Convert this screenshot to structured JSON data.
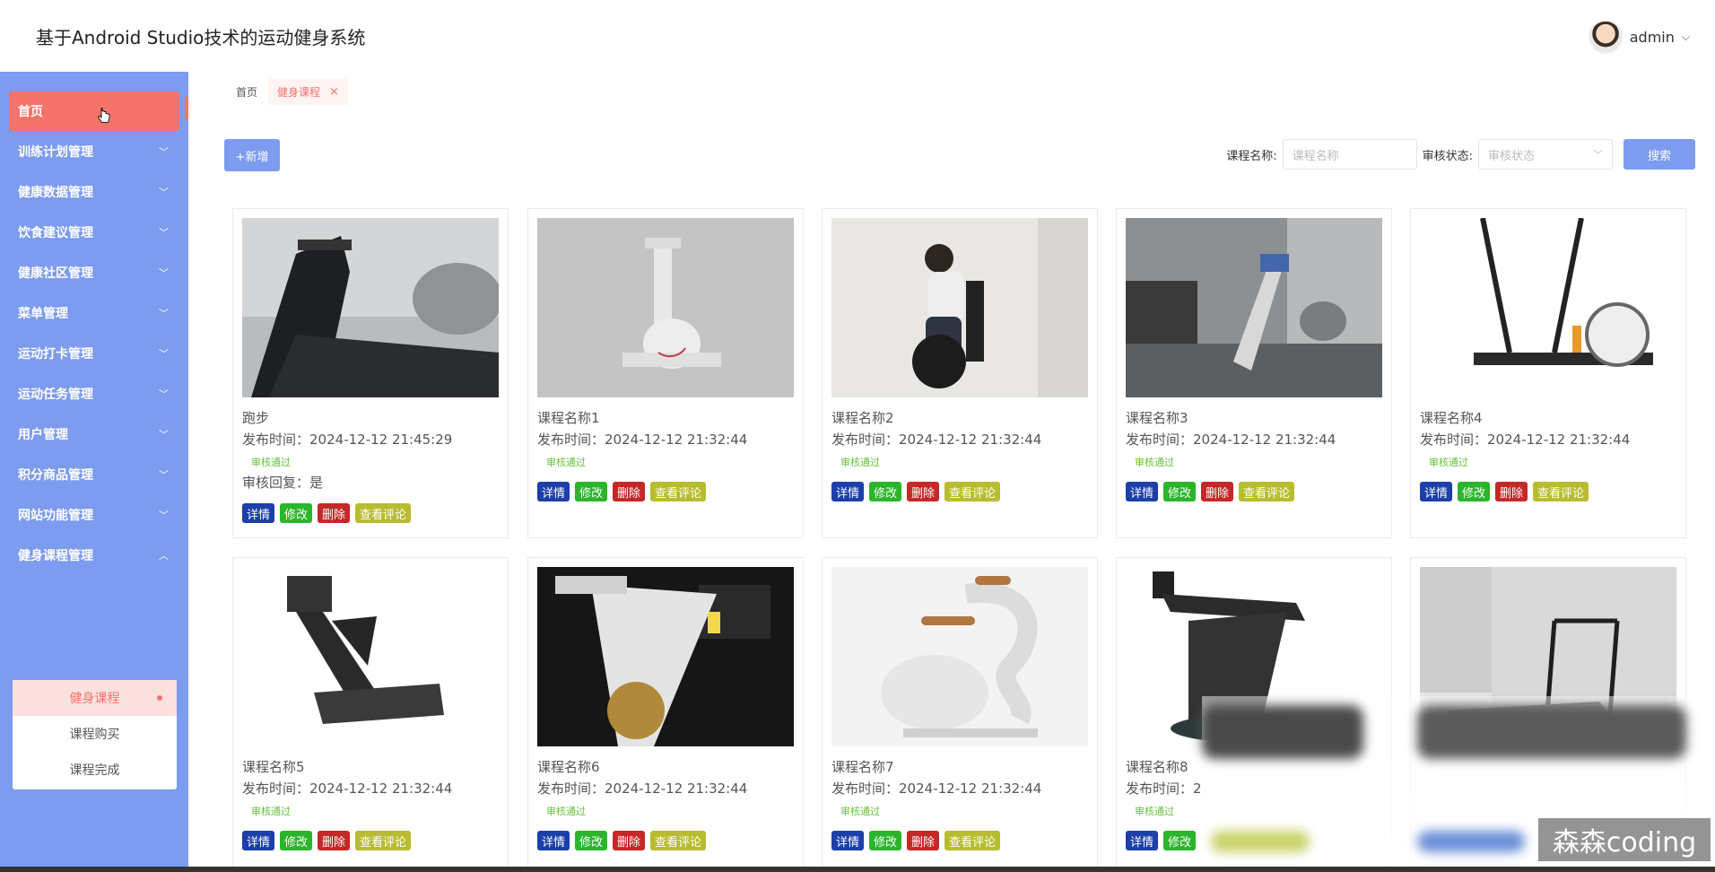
{
  "header": {
    "title": "基于Android Studio技术的运动健身系统",
    "user": "admin",
    "user_chevron": "⌵"
  },
  "sidebar": {
    "items": [
      {
        "label": "首页",
        "icon": "pointer-hand-icon"
      },
      {
        "label": "训练计划管理"
      },
      {
        "label": "健康数据管理"
      },
      {
        "label": "饮食建议管理"
      },
      {
        "label": "健康社区管理"
      },
      {
        "label": "菜单管理"
      },
      {
        "label": "运动打卡管理"
      },
      {
        "label": "运动任务管理"
      },
      {
        "label": "用户管理"
      },
      {
        "label": "积分商品管理"
      },
      {
        "label": "网站功能管理"
      },
      {
        "label": "健身课程管理"
      }
    ],
    "submenu": [
      {
        "label": "健身课程"
      },
      {
        "label": "课程购买"
      },
      {
        "label": "课程完成"
      }
    ],
    "colors": {
      "bg": "#7d9bef",
      "active": "#f5736a"
    }
  },
  "breadcrumb": {
    "home": "首页",
    "current": "健身课程",
    "close": "×"
  },
  "toolbar": {
    "add_label": "+新增",
    "name_label": "课程名称:",
    "name_placeholder": "课程名称",
    "status_label": "审核状态:",
    "status_placeholder": "审核状态",
    "search_label": "搜索"
  },
  "buttons": {
    "detail": "详情",
    "edit": "修改",
    "delete": "删除",
    "comments": "查看评论"
  },
  "cards": [
    {
      "name": "跑步",
      "time_label": "发布时间：",
      "time": "2024-12-12 21:45:29",
      "status": "审核通过",
      "reply": "审核回复：是"
    },
    {
      "name": "课程名称1",
      "time_label": "发布时间：",
      "time": "2024-12-12 21:32:44",
      "status": "审核通过"
    },
    {
      "name": "课程名称2",
      "time_label": "发布时间：",
      "time": "2024-12-12 21:32:44",
      "status": "审核通过"
    },
    {
      "name": "课程名称3",
      "time_label": "发布时间：",
      "time": "2024-12-12 21:32:44",
      "status": "审核通过"
    },
    {
      "name": "课程名称4",
      "time_label": "发布时间：",
      "time": "2024-12-12 21:32:44",
      "status": "审核通过"
    },
    {
      "name": "课程名称5",
      "time_label": "发布时间：",
      "time": "2024-12-12 21:32:44",
      "status": "审核通过"
    },
    {
      "name": "课程名称6",
      "time_label": "发布时间：",
      "time": "2024-12-12 21:32:44",
      "status": "审核通过"
    },
    {
      "name": "课程名称7",
      "time_label": "发布时间：",
      "time": "2024-12-12 21:32:44",
      "status": "审核通过"
    },
    {
      "name": "课程名称8",
      "time_label": "发布时间：",
      "time": "2",
      "status": "审核通过"
    }
  ],
  "watermark": "森森coding"
}
